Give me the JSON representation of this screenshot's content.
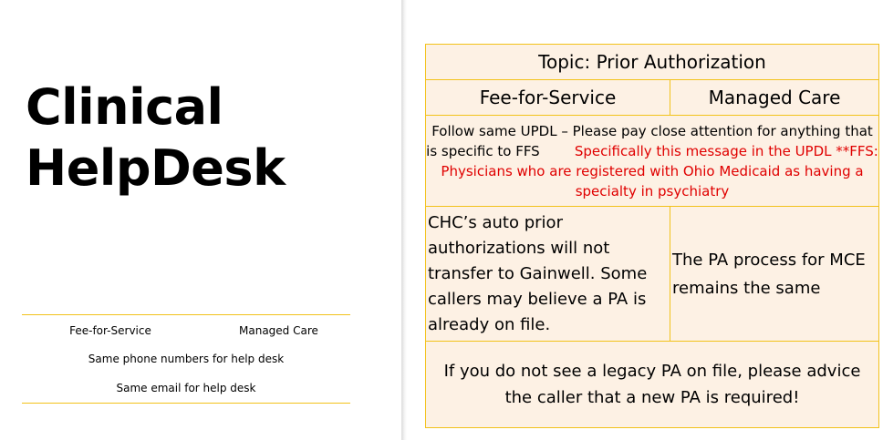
{
  "slide_title_line1": "Clinical",
  "slide_title_line2": "HelpDesk",
  "summary_table": {
    "col1": "Fee-for-Service",
    "col2": "Managed Care",
    "row_phone": "Same phone numbers for help desk",
    "row_email": "Same email for help desk"
  },
  "topic_table": {
    "topic": "Topic:  Prior Authorization",
    "header_ffs": "Fee-for-Service",
    "header_mc": "Managed Care",
    "note_black": "Follow same UPDL – Please pay close attention for anything that is specific to FFS",
    "note_red": "Specifically this message in the UPDL  **FFS: Physicians who are registered with Ohio Medicaid as having a specialty in psychiatry",
    "ffs_text": "CHC’s auto prior authorizations will not transfer to Gainwell.  Some callers may believe a PA is already on file.",
    "mc_text": " The PA process for MCE remains the same",
    "legacy_text": "If you do not see a legacy PA on file, please advice the caller that a new PA is required!"
  },
  "colors": {
    "accent_line": "#f2c21a",
    "cell_fill": "#fdf1e4",
    "highlight_red": "#e00000"
  }
}
